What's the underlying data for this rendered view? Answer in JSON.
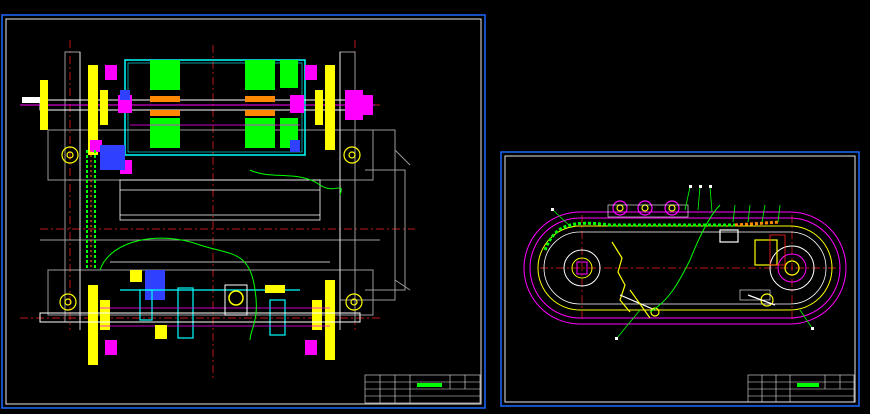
{
  "drawing": {
    "background": "#000000",
    "colors": {
      "frame_blue": "#1e6bff",
      "frame_white": "#e8e8e8",
      "yellow": "#ffff00",
      "cyan": "#00ffff",
      "magenta": "#ff00ff",
      "green": "#00ff00",
      "red": "#ff2020",
      "orange": "#ff8800",
      "blue": "#3040ff",
      "white": "#ffffff",
      "gray": "#9a9a9a"
    },
    "sheets": [
      {
        "name": "main-assembly-sheet",
        "has_title_block": true
      },
      {
        "name": "chain-drive-sheet",
        "has_title_block": true
      }
    ]
  }
}
